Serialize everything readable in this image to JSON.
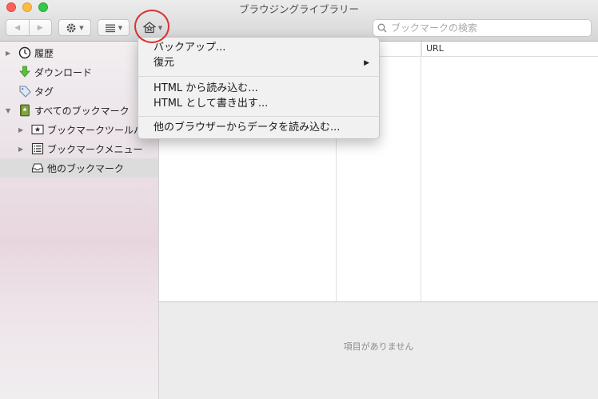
{
  "window": {
    "title": "ブラウジングライブラリー"
  },
  "toolbar": {
    "back_icon": "back-arrow-icon",
    "forward_icon": "forward-arrow-icon",
    "organize_icon": "gear-icon",
    "views_icon": "list-view-icon",
    "import_icon": "import-star-icon"
  },
  "search": {
    "placeholder": "ブックマークの検索"
  },
  "sidebar": {
    "items": [
      {
        "label": "履歴",
        "icon": "clock-icon"
      },
      {
        "label": "ダウンロード",
        "icon": "download-arrow-icon"
      },
      {
        "label": "タグ",
        "icon": "tag-icon"
      },
      {
        "label": "すべてのブックマーク",
        "icon": "bookmarks-book-icon"
      },
      {
        "label": "ブックマークツールバー",
        "icon": "star-toolbar-icon"
      },
      {
        "label": "ブックマークメニュー",
        "icon": "menu-list-icon"
      },
      {
        "label": "他のブックマーク",
        "icon": "tray-icon"
      }
    ]
  },
  "columns": {
    "url": "URL"
  },
  "details": {
    "empty_text": "項目がありません"
  },
  "menu": {
    "items": [
      {
        "label": "バックアップ..."
      },
      {
        "label": "復元"
      },
      {
        "label": "HTML から読み込む..."
      },
      {
        "label": "HTML として書き出す..."
      },
      {
        "label": "他のブラウザーからデータを読み込む..."
      }
    ]
  },
  "colors": {
    "highlight_circle": "#d83232",
    "selection": "#dcdcdc"
  }
}
